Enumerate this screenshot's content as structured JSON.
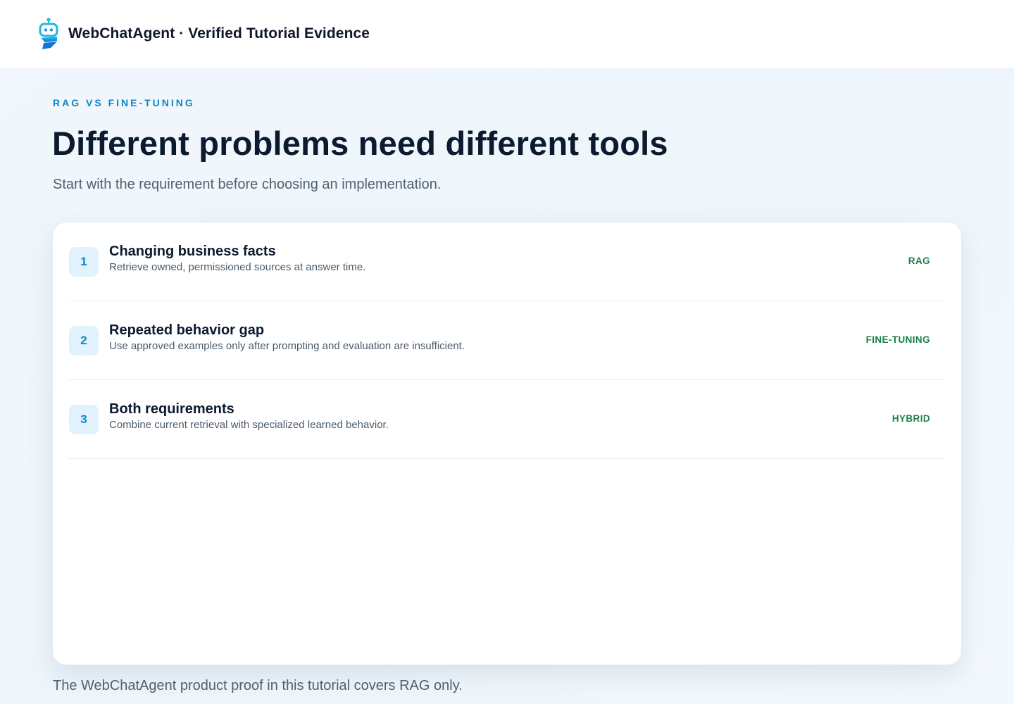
{
  "header": {
    "brand": "WebChatAgent · Verified Tutorial Evidence",
    "logo_icon": "robot-chat-icon",
    "logo_colors": [
      "#22b8e6",
      "#1276d3"
    ]
  },
  "hero": {
    "eyebrow": "RAG VS FINE-TUNING",
    "title": "Different problems need different tools",
    "subtitle": "Start with the requirement before choosing an implementation."
  },
  "comparison": {
    "rows": [
      {
        "number": "1",
        "title": "Changing business facts",
        "description": "Retrieve owned, permissioned sources at answer time.",
        "tag": "RAG"
      },
      {
        "number": "2",
        "title": "Repeated behavior gap",
        "description": "Use approved examples only after prompting and evaluation are insufficient.",
        "tag": "FINE-TUNING"
      },
      {
        "number": "3",
        "title": "Both requirements",
        "description": "Combine current retrieval with specialized learned behavior.",
        "tag": "HYBRID"
      }
    ]
  },
  "footer": {
    "note": "The WebChatAgent product proof in this tutorial covers RAG only."
  },
  "colors": {
    "accent": "#0e86c2",
    "tag": "#1a7f4e",
    "badge_bg": "#e2f2fc"
  }
}
